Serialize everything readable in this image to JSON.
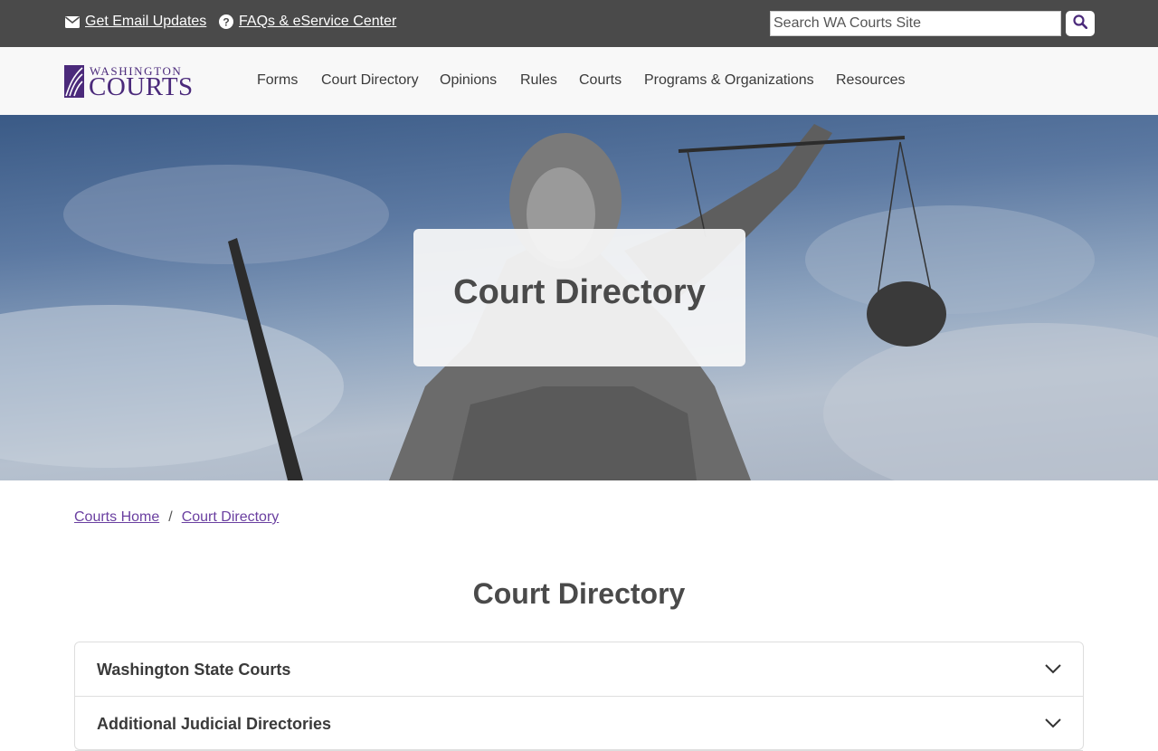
{
  "utility": {
    "email_label": "Get Email Updates",
    "faq_label": "FAQs & eService Center",
    "search_placeholder": "Search WA Courts Site"
  },
  "logo": {
    "top_text": "WASHINGTON",
    "main_text": "COURTS"
  },
  "nav": {
    "items": [
      {
        "label": "Forms"
      },
      {
        "label": "Court Directory"
      },
      {
        "label": "Opinions"
      },
      {
        "label": "Rules"
      },
      {
        "label": "Courts"
      },
      {
        "label": "Programs & Organizations"
      },
      {
        "label": "Resources"
      }
    ]
  },
  "hero": {
    "title": "Court Directory"
  },
  "breadcrumb": {
    "items": [
      {
        "label": "Courts Home"
      },
      {
        "label": "Court Directory"
      }
    ],
    "separator": "/"
  },
  "page": {
    "heading": "Court Directory"
  },
  "accordion": {
    "items": [
      {
        "label": "Washington State Courts"
      },
      {
        "label": "Additional Judicial Directories"
      }
    ]
  },
  "colors": {
    "brand_purple": "#4b2a7b",
    "link_purple": "#6a3fa0",
    "topbar": "#4a4a4a"
  },
  "icons": [
    "envelope-icon",
    "question-circle-icon",
    "search-icon",
    "chevron-down-icon"
  ]
}
